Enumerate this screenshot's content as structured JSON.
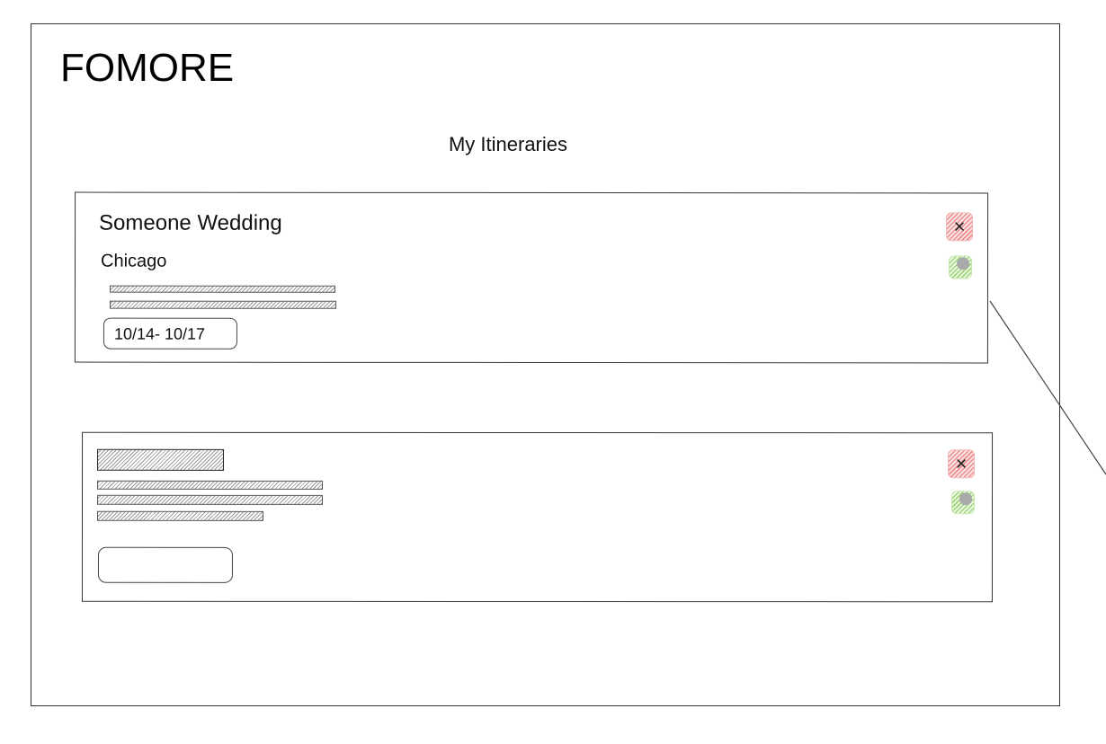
{
  "app": {
    "brand": "FOMORE",
    "page_title": "My Itineraries"
  },
  "colors": {
    "delete_accent": "#ee8d8d",
    "edit_accent": "#9fd679",
    "edit_knob": "#a9a9a9",
    "border": "#333333"
  },
  "itineraries": [
    {
      "title": "Someone Wedding",
      "city": "Chicago",
      "dates": "10/14- 10/17",
      "delete_icon": "close-icon",
      "edit_icon": "edit-icon"
    },
    {
      "title": "",
      "city": "",
      "dates": "",
      "delete_icon": "close-icon",
      "edit_icon": "edit-icon"
    }
  ],
  "icons": {
    "close_glyph": "×"
  }
}
